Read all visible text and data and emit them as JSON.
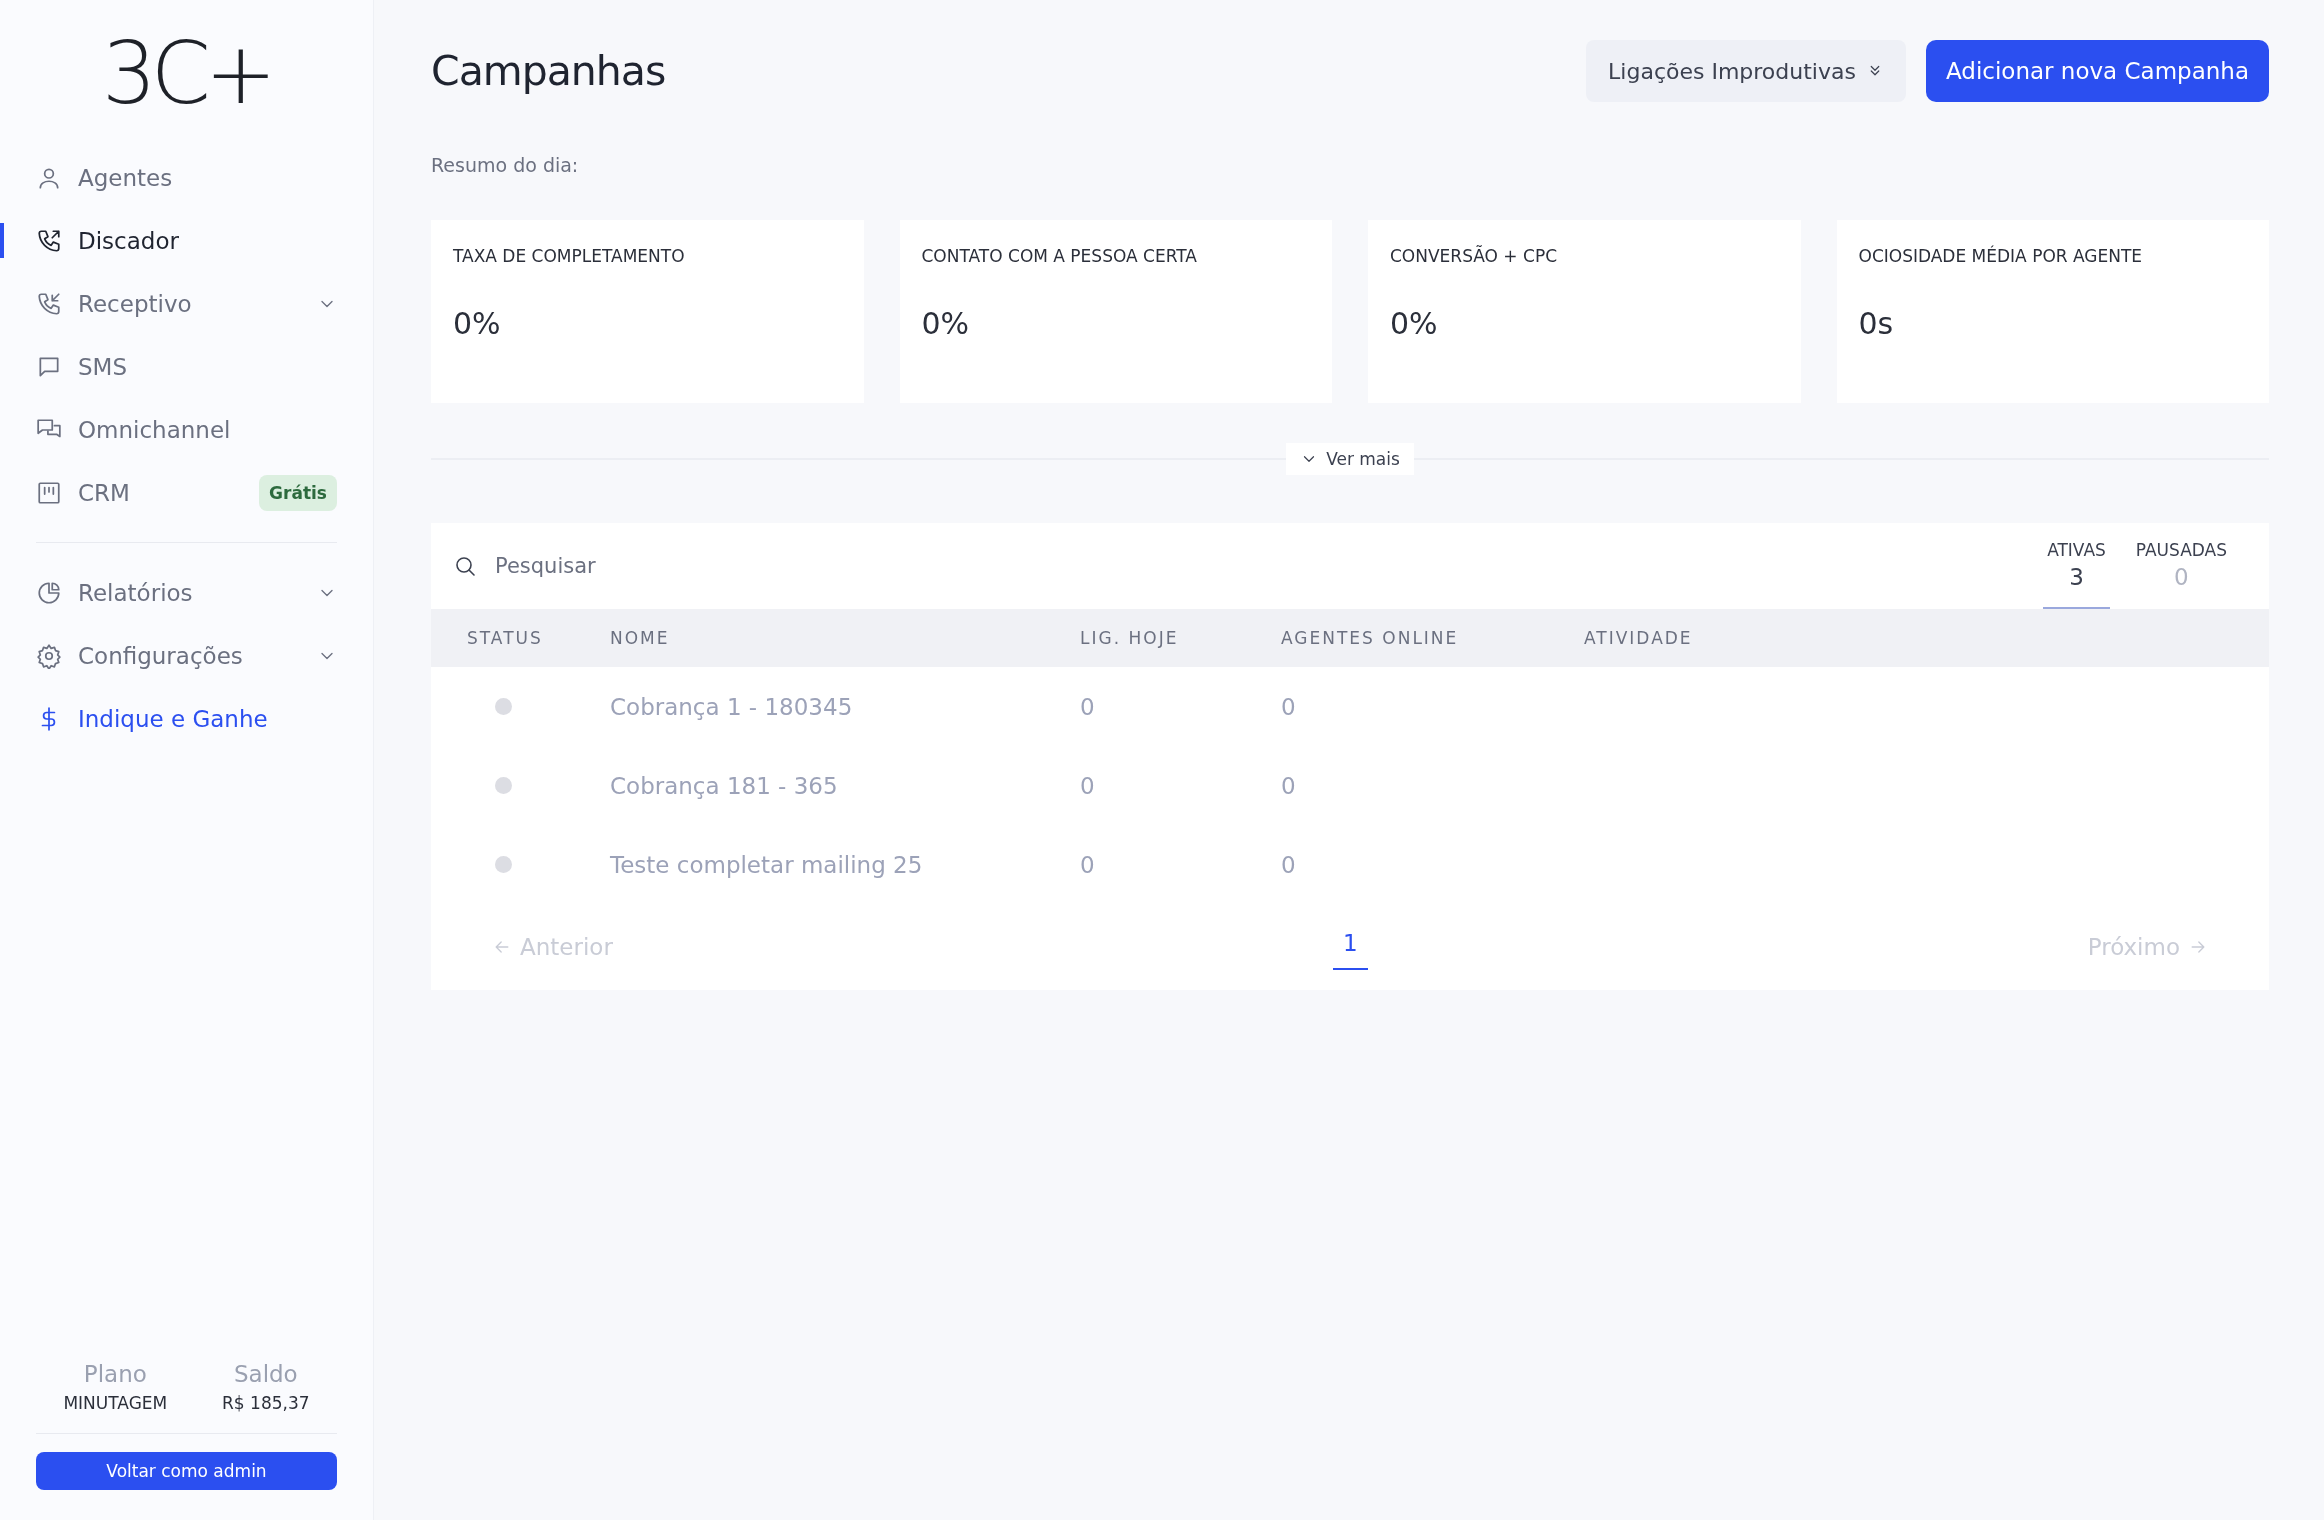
{
  "sidebar": {
    "logo": "3C+",
    "nav_groups": [
      [
        {
          "label": "Agentes",
          "selected": false,
          "expandable": false
        },
        {
          "label": "Discador",
          "selected": true,
          "expandable": false
        },
        {
          "label": "Receptivo",
          "selected": false,
          "expandable": true
        },
        {
          "label": "SMS",
          "selected": false,
          "expandable": false
        },
        {
          "label": "Omnichannel",
          "selected": false,
          "expandable": false
        },
        {
          "label": "CRM",
          "selected": false,
          "expandable": false,
          "badge": "Grátis"
        }
      ],
      [
        {
          "label": "Relatórios",
          "selected": false,
          "expandable": true
        },
        {
          "label": "Configurações",
          "selected": false,
          "expandable": true
        },
        {
          "label": "Indique e Ganhe",
          "selected": false,
          "expandable": false,
          "kind": "promo"
        }
      ]
    ],
    "footer": {
      "stats": [
        {
          "label": "Plano",
          "value": "MINUTAGEM"
        },
        {
          "label": "Saldo",
          "value": "R$ 185,37"
        }
      ],
      "button": "Voltar como admin"
    }
  },
  "header": {
    "title": "Campanhas",
    "filter": "Ligações Improdutivas",
    "add_button": "Adicionar nova Campanha"
  },
  "summary": {
    "label": "Resumo do dia:",
    "cards": [
      {
        "title": "TAXA DE COMPLETAMENTO",
        "value": "0%"
      },
      {
        "title": "CONTATO COM A PESSOA CERTA",
        "value": "0%"
      },
      {
        "title": "CONVERSÃO + CPC",
        "value": "0%"
      },
      {
        "title": "OCIOSIDADE MÉDIA POR AGENTE",
        "value": "0s"
      }
    ],
    "more": "Ver mais"
  },
  "campaigns": {
    "search": {
      "placeholder": "Pesquisar"
    },
    "tabs": [
      {
        "label": "ATIVAS",
        "count": "3",
        "selected": true
      },
      {
        "label": "PAUSADAS",
        "count": "0",
        "selected": false
      }
    ],
    "columns": [
      "STATUS",
      "NOME",
      "LIG. HOJE",
      "AGENTES ONLINE",
      "ATIVIDADE"
    ],
    "rows": [
      {
        "color": "#dcdde3",
        "name": "Cobrança 1 - 180345",
        "calls": "0",
        "agents": "0"
      },
      {
        "color": "#dcdde3",
        "name": "Cobrança 181 - 365",
        "calls": "0",
        "agents": "0"
      },
      {
        "color": "#dcdde3",
        "name": "Teste completar mailing 25",
        "calls": "0",
        "agents": "0"
      }
    ],
    "pagination": {
      "previous": {
        "label": "Anterior",
        "disabled": true
      },
      "pages": [
        {
          "label": "1",
          "selected": true
        }
      ],
      "next": {
        "label": "Próximo",
        "disabled": true
      }
    }
  }
}
